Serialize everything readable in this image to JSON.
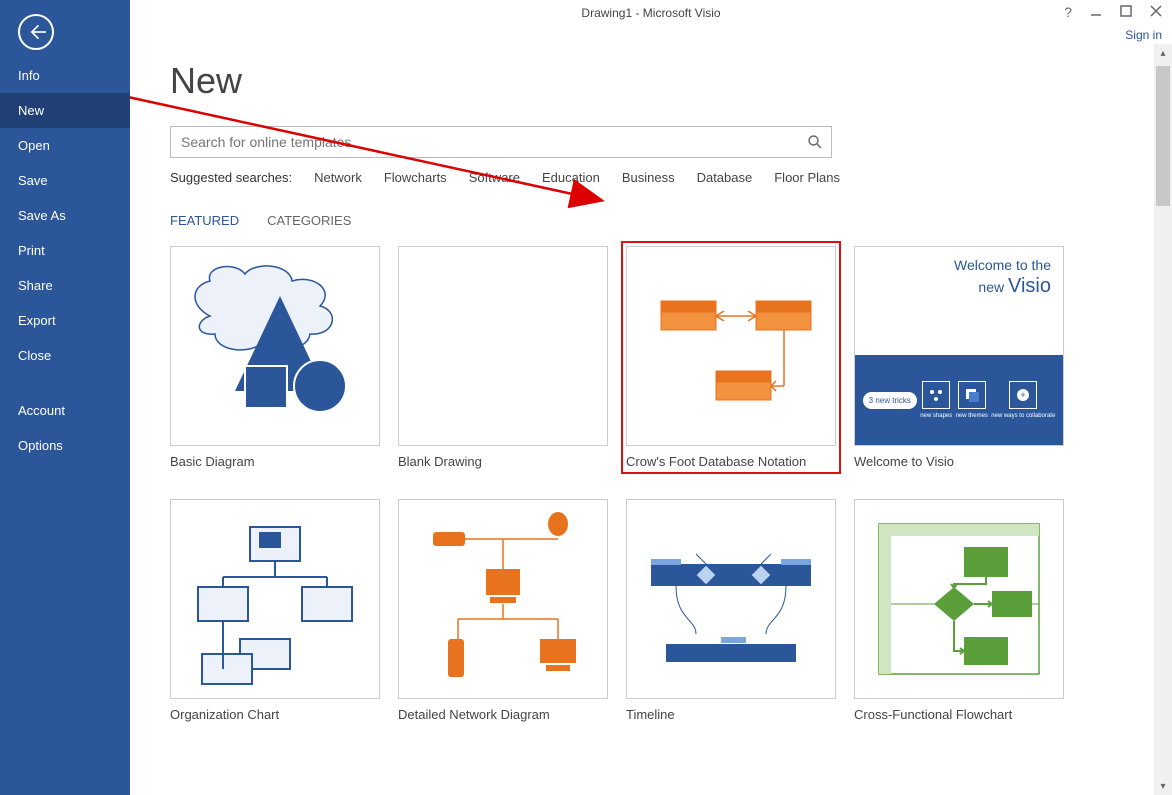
{
  "window": {
    "title": "Drawing1 - Microsoft Visio",
    "help_glyph": "?",
    "sign_in": "Sign in"
  },
  "sidebar": {
    "items": [
      {
        "label": "Info"
      },
      {
        "label": "New",
        "selected": true
      },
      {
        "label": "Open"
      },
      {
        "label": "Save"
      },
      {
        "label": "Save As"
      },
      {
        "label": "Print"
      },
      {
        "label": "Share"
      },
      {
        "label": "Export"
      },
      {
        "label": "Close"
      }
    ],
    "footer": [
      {
        "label": "Account"
      },
      {
        "label": "Options"
      }
    ]
  },
  "page": {
    "title": "New",
    "search_placeholder": "Search for online templates",
    "suggested_label": "Suggested searches:",
    "suggested": [
      "Network",
      "Flowcharts",
      "Software",
      "Education",
      "Business",
      "Database",
      "Floor Plans"
    ],
    "tabs": [
      {
        "label": "FEATURED",
        "active": true
      },
      {
        "label": "CATEGORIES"
      }
    ],
    "templates": [
      {
        "label": "Basic Diagram",
        "kind": "basic"
      },
      {
        "label": "Blank Drawing",
        "kind": "blank"
      },
      {
        "label": "Crow's Foot Database Notation",
        "kind": "crowfoot",
        "highlight": true
      },
      {
        "label": "Welcome to Visio",
        "kind": "welcome"
      },
      {
        "label": "Organization Chart",
        "kind": "org"
      },
      {
        "label": "Detailed Network Diagram",
        "kind": "network"
      },
      {
        "label": "Timeline",
        "kind": "timeline"
      },
      {
        "label": "Cross-Functional Flowchart",
        "kind": "cross"
      }
    ],
    "welcome_tile": {
      "line1": "Welcome to the",
      "line2_a": "new ",
      "line2_b": "Visio",
      "badge": "3 new tricks",
      "icons": [
        "new shapes",
        "new themes",
        "new ways to collaborate"
      ]
    }
  }
}
